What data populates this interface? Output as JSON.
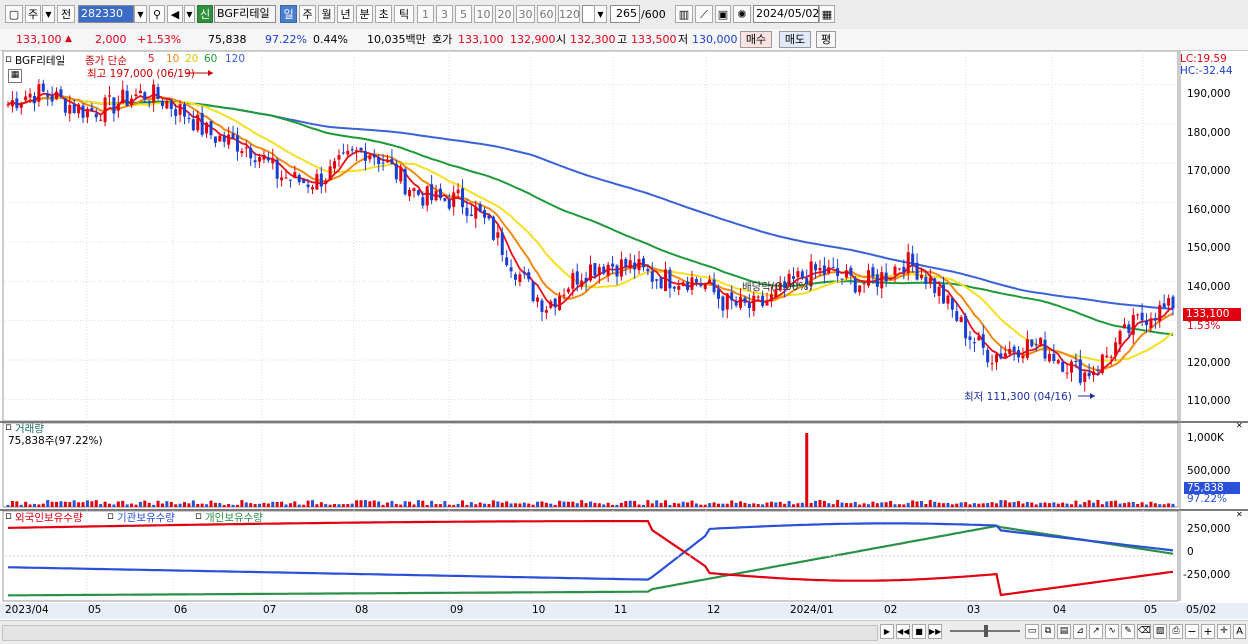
{
  "toolbar": {
    "view_label": "주",
    "prev_label": "전",
    "code": "282330",
    "badge": "신",
    "name": "BGF리테일",
    "periods": [
      "일",
      "주",
      "월",
      "년",
      "분",
      "초",
      "틱"
    ],
    "multipliers": [
      "1",
      "3",
      "5",
      "10",
      "20",
      "30",
      "60",
      "120"
    ],
    "count": "265",
    "count_total": "/600",
    "date": "2024/05/02"
  },
  "info": {
    "price": "133,100",
    "change": "2,000",
    "change_pct": "+1.53%",
    "volume": "75,838",
    "vol_ratio": "97.22%",
    "turnover_pct": "0.44%",
    "amount": "10,035백만",
    "bid_label": "호가",
    "bid1": "133,100",
    "bid2": "132,900",
    "open_label": "시",
    "open": "132,300",
    "high_label": "고",
    "high": "133,500",
    "low_label": "저",
    "low": "130,000",
    "buy_label": "매수",
    "sell_label": "매도",
    "avg_label": "평"
  },
  "price_pane": {
    "title": "BGF리테일",
    "legend_label": "종가 단순",
    "ma_periods": [
      "5",
      "10",
      "20",
      "60",
      "120"
    ],
    "ma_colors": [
      "#e8101a",
      "#f08a10",
      "#f5e020",
      "#1e9a3a",
      "#3a62d8"
    ],
    "high_annotation": "최고 197,000 (06/19)",
    "low_annotation": "최저 111,300 (04/16)",
    "dividend_annotation": "배당락(0.00%)",
    "lc": "LC:19.59",
    "hc": "HC:-32.44",
    "current_price_tag": "133,100",
    "current_pct_tag": "1.53%",
    "y_ticks": [
      "190,000",
      "180,000",
      "170,000",
      "160,000",
      "150,000",
      "140,000",
      "130,000",
      "120,000",
      "110,000"
    ]
  },
  "volume_pane": {
    "title": "거래량",
    "subtitle": "75,838주(97.22%)",
    "y_ticks": [
      "1,000K",
      "500,000"
    ],
    "tag": "75,838",
    "tag_pct": "97.22%"
  },
  "holdings_pane": {
    "series_labels": [
      "외국인보유수량",
      "기관보유수량",
      "개인보유수량"
    ],
    "series_colors": [
      "#e00010",
      "#2a50d8",
      "#2a9048"
    ],
    "y_ticks": [
      "250,000",
      "0",
      "-250,000"
    ]
  },
  "x_axis": [
    "2023/04",
    "05",
    "06",
    "07",
    "08",
    "09",
    "10",
    "11",
    "12",
    "2024/01",
    "02",
    "03",
    "04",
    "05",
    "05/02"
  ],
  "chart_data": {
    "type": "line",
    "title": "BGF리테일",
    "series": [
      {
        "name": "120",
        "x": [
          "2023/04",
          "2023/05",
          "2023/06",
          "2023/07",
          "2023/08",
          "2023/09",
          "2023/10",
          "2023/11",
          "2023/12",
          "2024/01",
          "2024/02",
          "2024/03",
          "2024/04",
          "2024/05"
        ],
        "values": [
          190000,
          189000,
          188000,
          183000,
          178000,
          175000,
          169000,
          162000,
          155000,
          149000,
          145000,
          141000,
          137000,
          133000
        ]
      },
      {
        "name": "60",
        "x": [
          "2023/04",
          "2023/05",
          "2023/06",
          "2023/07",
          "2023/08",
          "2023/09",
          "2023/10",
          "2023/11",
          "2023/12",
          "2024/01",
          "2024/02",
          "2024/03",
          "2024/04",
          "2024/05"
        ],
        "values": [
          183000,
          182500,
          183000,
          183500,
          174000,
          166000,
          158000,
          150000,
          142000,
          139000,
          139500,
          136000,
          132000,
          126500
        ]
      },
      {
        "name": "종가",
        "x": [
          "2023/04",
          "2023/05",
          "2023/06",
          "2023/07",
          "2023/08",
          "2023/09",
          "2023/10",
          "2023/11",
          "2023/12",
          "2024/01",
          "2024/02",
          "2024/03",
          "2024/04",
          "2024/05"
        ],
        "values": [
          185000,
          186000,
          184000,
          166000,
          171000,
          160000,
          136000,
          146000,
          134000,
          140000,
          144000,
          123000,
          119000,
          133100
        ]
      }
    ],
    "ylim": [
      105000,
      197000
    ],
    "high": {
      "value": 197000,
      "date": "06/19"
    },
    "low": {
      "value": 111300,
      "date": "04/16"
    },
    "volume_spike_month": "12",
    "holdings_ylim": [
      -400000,
      400000
    ]
  }
}
